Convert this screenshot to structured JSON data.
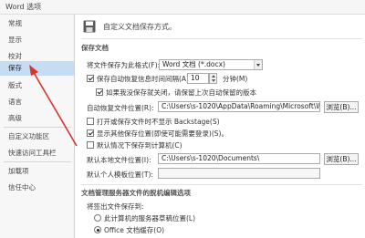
{
  "window": {
    "title": "Word 选项"
  },
  "sidebar": {
    "items": [
      {
        "label": "常规"
      },
      {
        "label": "显示"
      },
      {
        "label": "校对"
      },
      {
        "label": "保存"
      },
      {
        "label": "版式"
      },
      {
        "label": "语言"
      },
      {
        "label": "高级"
      },
      {
        "label": "自定义功能区"
      },
      {
        "label": "快速访问工具栏"
      },
      {
        "label": "加载项"
      },
      {
        "label": "信任中心"
      }
    ],
    "active": "保存"
  },
  "header": {
    "text": "自定义文档保存方式。"
  },
  "save_docs": {
    "section_title": "保存文档",
    "format_label": "将文件保存为此格式(F):",
    "format_value": "Word 文档 (*.docx)",
    "autorecover_label": "保存自动恢复信息时间间隔(A)",
    "autorecover_value": "10",
    "minutes_label": "分钟(M)",
    "keep_last_label": "如果我没保存就关闭，请保留上次自动保留的版本",
    "autorecover_loc_label": "自动恢复文件位置(R):",
    "autorecover_loc_value": "C:\\Users\\s-1020\\AppData\\Roaming\\Microsoft\\Word\\",
    "browse_label": "浏览(B)...",
    "no_backstage_label": "打开或保存文件时不显示 Backstage(S)",
    "show_other_label": "显示其他保存位置(即使可能需要登录)(S)。",
    "default_computer_label": "默认情况下保存到计算机(C)",
    "local_loc_label": "默认本地文件位置(I):",
    "local_loc_value": "C:\\Users\\s-1020\\Documents\\",
    "browse2_label": "浏览(B)...",
    "template_loc_label": "默认个人模板位置(T):",
    "template_loc_value": ""
  },
  "offline": {
    "section_title": "文档管理服务器文件的脱机编辑选项",
    "checkout_label": "将签出文件保存到:",
    "server_drafts_label": "此计算机的服务器草稿位置(L)",
    "office_cache_label": "Office 文档缓存(O)"
  },
  "colors": {
    "active_item": "#c5dcf2",
    "annotation_arrow": "#d9342b"
  }
}
